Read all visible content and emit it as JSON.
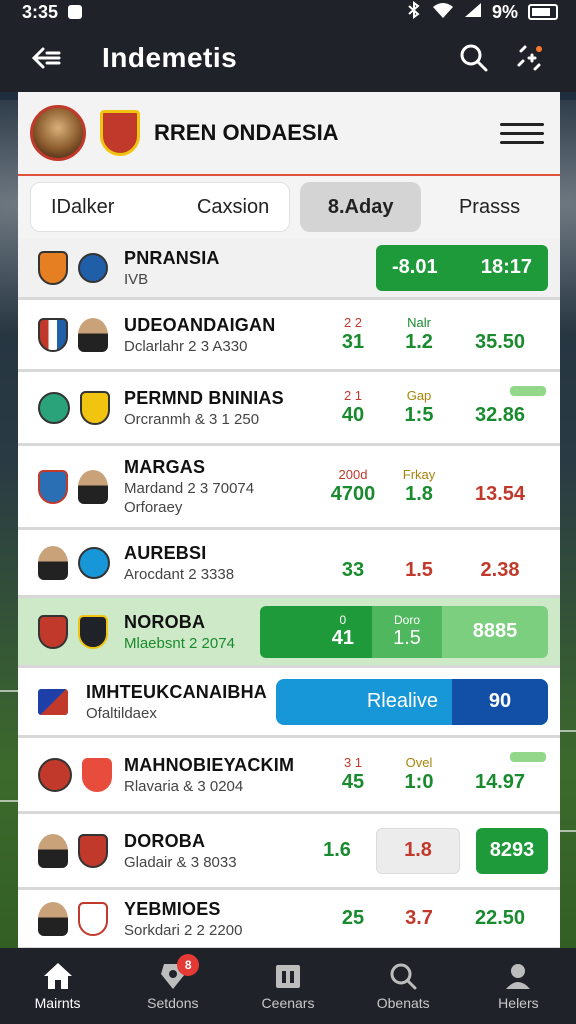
{
  "status_bar": {
    "time": "3:35",
    "battery_text": "9%"
  },
  "app_bar": {
    "title": "Indemetis"
  },
  "header": {
    "team_title": "RREN ONDAESIA"
  },
  "tabs": [
    {
      "label": "IDalker"
    },
    {
      "label": "Caxsion"
    },
    {
      "label": "8.Aday"
    },
    {
      "label": "Prasss"
    }
  ],
  "matches": [
    {
      "name": "PNRANSIA",
      "sub": "IVB",
      "btn_left": "-8.01",
      "btn_right": "18:17"
    },
    {
      "name": "UDEOANDAIGAN",
      "sub": "Dclarlahr 2 3 A330",
      "o1_lbl": "2 2",
      "o1": "31",
      "o2_lbl": "Nalr",
      "o2": "1.2",
      "o3": "35.50"
    },
    {
      "name": "PERMND BNINIAS",
      "sub": "Orcranmh & 3 1 250",
      "o1_lbl": "2 1",
      "o1": "40",
      "o2_lbl": "Gap",
      "o2": "1:5",
      "o3": "32.86"
    },
    {
      "name": "MARGAS",
      "sub": "Mardand 2 3 70074",
      "sub2": "Orforaey",
      "o1_lbl": "200d",
      "o1": "4700",
      "o2_lbl": "Frkay",
      "o2": "1.8",
      "o3": "13.54"
    },
    {
      "name": "AUREBSI",
      "sub": "Arocdant 2 3338",
      "o1": "33",
      "o2": "1.5",
      "o3": "2.38"
    },
    {
      "name": "NOROBA",
      "sub": "Mlaebsnt 2 2074",
      "o1_lbl": "0",
      "o1": "41",
      "o2_lbl": "Doro",
      "o2": "1.5",
      "o3": "8885"
    },
    {
      "name": "IMHTEUKCANAIBHA",
      "sub": "Ofaltildaex",
      "btn_label": "Rlealive",
      "btn_value": "90"
    },
    {
      "name": "MAHNOBIEYACKIM",
      "sub": "Rlavaria & 3 0204",
      "o1_lbl": "3 1",
      "o1": "45",
      "o2_lbl": "Ovel",
      "o2": "1:0",
      "o3": "14.97"
    },
    {
      "name": "DOROBA",
      "sub": "Gladair & 3 8033",
      "o1": "1.6",
      "o2": "1.8",
      "o3": "8293"
    },
    {
      "name": "YEBMIOES",
      "sub": "Sorkdari 2 2 2200",
      "o1": "25",
      "o2": "3.7",
      "o3": "22.50"
    }
  ],
  "bottom_nav": [
    {
      "label": "Mairnts"
    },
    {
      "label": "Setdons",
      "badge": "8"
    },
    {
      "label": "Ceenars"
    },
    {
      "label": "Obenats"
    },
    {
      "label": "Helers"
    }
  ],
  "colors": {
    "bar_bg": "#1f2228",
    "accent_green": "#1e9a3a",
    "accent_red": "#c0392b",
    "accent_blue": "#1796d8"
  }
}
